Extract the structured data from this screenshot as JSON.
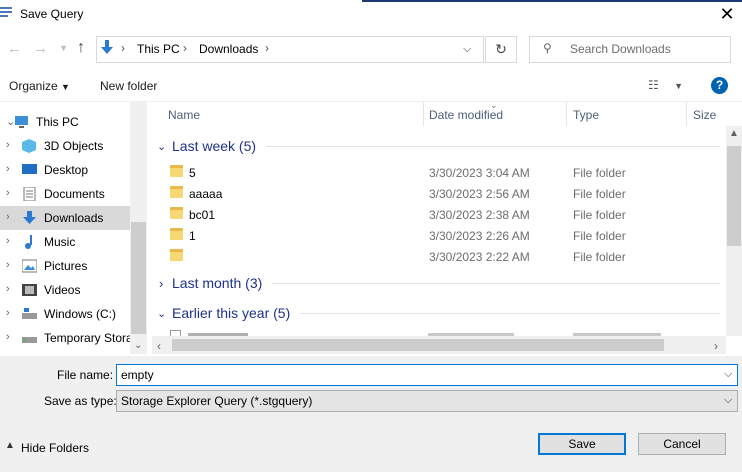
{
  "window": {
    "title": "Save Query",
    "close_glyph": "✕"
  },
  "nav": {
    "back_icon": "back-arrow-icon",
    "forward_icon": "forward-arrow-icon",
    "recent_icon": "chevron-down-icon",
    "up_icon": "up-arrow-icon",
    "breadcrumb": [
      "This PC",
      "Downloads"
    ],
    "search_placeholder": "Search Downloads"
  },
  "commands": {
    "organize": "Organize",
    "new_folder": "New folder",
    "help": "?"
  },
  "sidebar": {
    "items": [
      {
        "label": "This PC",
        "icon": "pc-icon",
        "expanded": true
      },
      {
        "label": "3D Objects",
        "icon": "3d-objects-icon"
      },
      {
        "label": "Desktop",
        "icon": "desktop-icon"
      },
      {
        "label": "Documents",
        "icon": "documents-icon"
      },
      {
        "label": "Downloads",
        "icon": "downloads-icon",
        "selected": true
      },
      {
        "label": "Music",
        "icon": "music-icon"
      },
      {
        "label": "Pictures",
        "icon": "pictures-icon"
      },
      {
        "label": "Videos",
        "icon": "videos-icon"
      },
      {
        "label": "Windows (C:)",
        "icon": "drive-icon"
      },
      {
        "label": "Temporary Stora",
        "icon": "drive-icon"
      }
    ]
  },
  "columns": {
    "name": "Name",
    "date": "Date modified",
    "type": "Type",
    "size": "Size"
  },
  "groups": [
    {
      "title": "Last week (5)",
      "expanded": true,
      "rows": [
        {
          "name": "5",
          "date": "3/30/2023 3:04 AM",
          "type": "File folder"
        },
        {
          "name": "aaaaa",
          "date": "3/30/2023 2:56 AM",
          "type": "File folder"
        },
        {
          "name": "bc01",
          "date": "3/30/2023 2:38 AM",
          "type": "File folder"
        },
        {
          "name": "1",
          "date": "3/30/2023 2:26 AM",
          "type": "File folder"
        },
        {
          "name": "",
          "date": "3/30/2023 2:22 AM",
          "type": "File folder"
        }
      ]
    },
    {
      "title": "Last month (3)",
      "expanded": false
    },
    {
      "title": "Earlier this year (5)",
      "expanded": true
    }
  ],
  "footer": {
    "file_name_label": "File name:",
    "file_name_value": "empty",
    "save_type_label": "Save as type:",
    "save_type_value": "Storage Explorer Query (*.stgquery)",
    "hide_folders": "Hide Folders",
    "save": "Save",
    "cancel": "Cancel"
  },
  "colors": {
    "accent": "#0078d7",
    "group_title": "#1e3287",
    "selected_bg": "#d9d9d9",
    "folder": "#f8d775"
  }
}
